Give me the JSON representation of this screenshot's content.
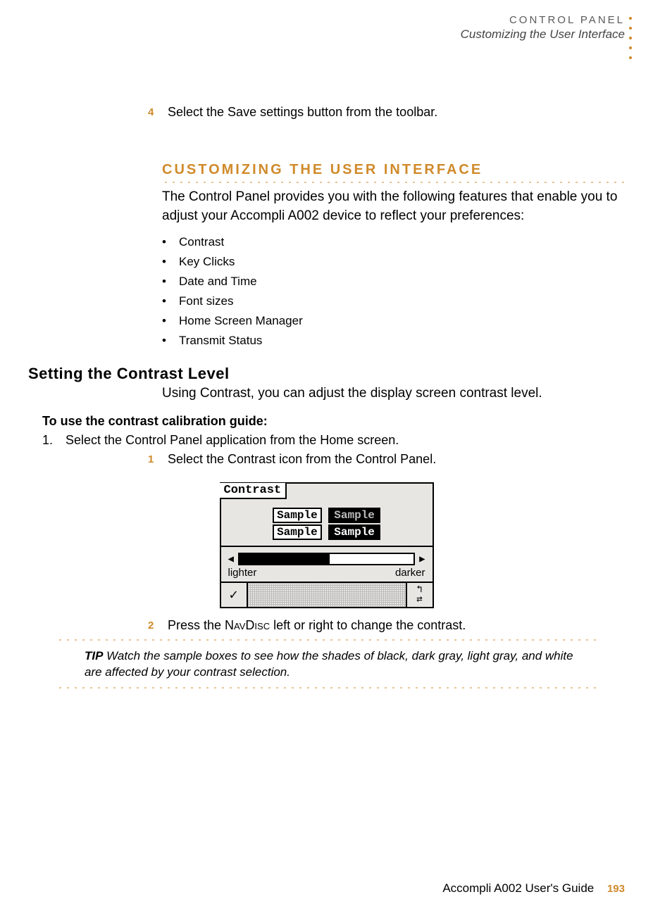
{
  "header": {
    "title": "CONTROL PANEL",
    "subtitle": "Customizing the User Interface"
  },
  "step4": {
    "num": "4",
    "text": "Select the Save settings button from the toolbar."
  },
  "section": {
    "heading": "CUSTOMIZING THE USER INTERFACE",
    "intro": "The Control Panel provides you with the following features that enable you to adjust your Accompli A002 device to reflect your preferences:",
    "bullets": [
      "Contrast",
      "Key Clicks",
      "Date and Time",
      "Font sizes",
      "Home Screen Manager",
      "Transmit Status"
    ]
  },
  "contrast": {
    "heading": "Setting the Contrast Level",
    "intro": "Using Contrast, you can adjust the display screen contrast level.",
    "guide_heading": "To use the contrast calibration guide:",
    "step_list_1_num": "1.",
    "step_list_1_text": "Select the Control Panel application from the Home screen.",
    "inner1_num": "1",
    "inner1_text": "Select the Contrast icon from the Control Panel.",
    "inner2_num": "2",
    "inner2_pre": "Press the ",
    "inner2_nav": "NavDisc",
    "inner2_post": " left or right to change the contrast."
  },
  "figure": {
    "title": "Contrast",
    "sample": "Sample",
    "lighter": "lighter",
    "darker": "darker"
  },
  "tip": {
    "label": "TIP",
    "text": " Watch the sample boxes to see how the shades of black, dark gray, light gray, and white are affected by your contrast selection."
  },
  "footer": {
    "book": "Accompli A002 User's Guide",
    "page": "193"
  }
}
